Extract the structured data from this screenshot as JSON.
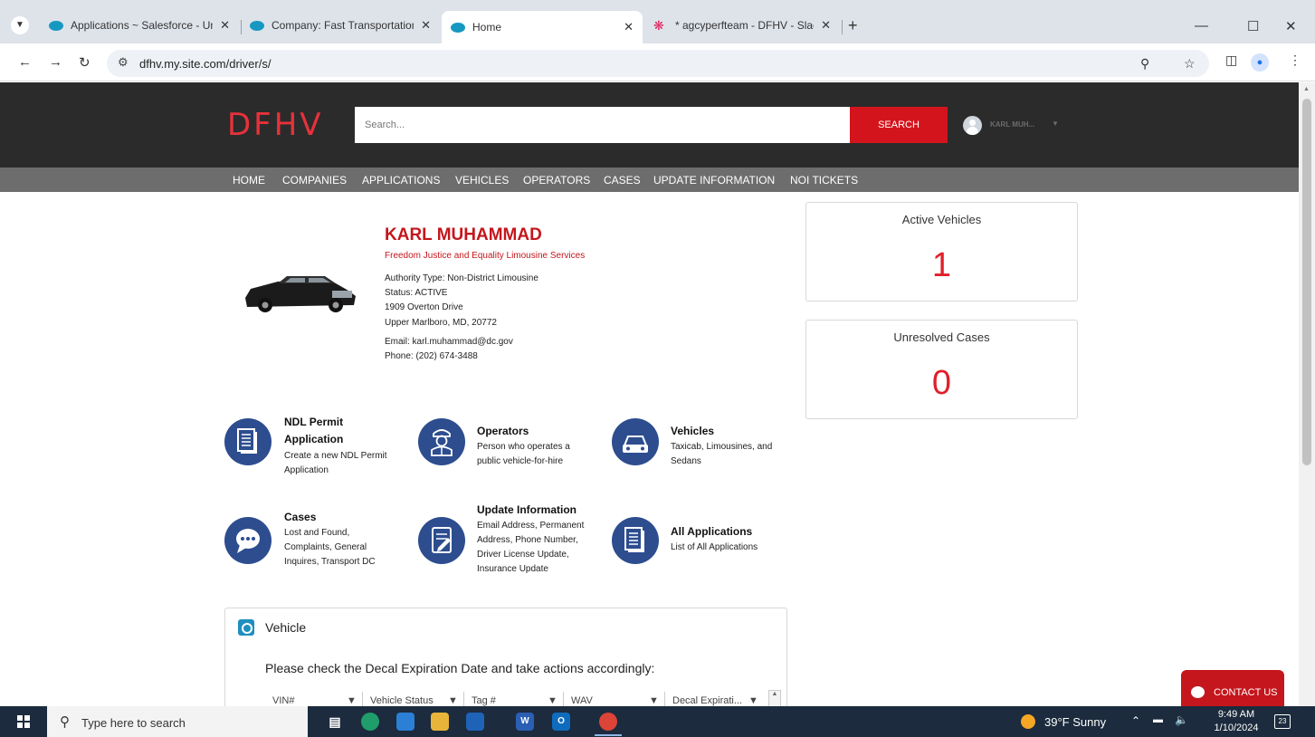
{
  "browser": {
    "tabs": [
      {
        "label": "Applications ~ Salesforce - Unli"
      },
      {
        "label": "Company: Fast Transportation S"
      },
      {
        "label": "Home"
      },
      {
        "label": "* agcyperfteam - DFHV - Slack"
      }
    ],
    "url": "dfhv.my.site.com/driver/s/"
  },
  "site": {
    "logo": "DFHV",
    "search_placeholder": "Search...",
    "search_button": "SEARCH",
    "user_name": "KARL MUH...",
    "nav": [
      "HOME",
      "COMPANIES",
      "APPLICATIONS",
      "VEHICLES",
      "OPERATORS",
      "CASES",
      "UPDATE INFORMATION",
      "NOI TICKETS"
    ]
  },
  "profile": {
    "name": "KARL MUHAMMAD",
    "company": "Freedom Justice and Equality Limousine Services",
    "authority": "Authority Type: Non-District Limousine",
    "status": "Status: ACTIVE",
    "address1": "1909 Overton Drive",
    "address2": "Upper Marlboro, MD, 20772",
    "email": "Email: karl.muhammad@dc.gov",
    "phone": "Phone: (202) 674-3488"
  },
  "stats": {
    "active_vehicles": {
      "title": "Active Vehicles",
      "value": "1"
    },
    "unresolved_cases": {
      "title": "Unresolved Cases",
      "value": "0"
    }
  },
  "tiles": {
    "ndl": {
      "title1": "NDL Permit",
      "title2": "Application",
      "desc1": "Create a new NDL Permit",
      "desc2": "Application",
      "icon": "document-stack-icon"
    },
    "operators": {
      "title": "Operators",
      "desc1": "Person who operates a",
      "desc2": "public vehicle-for-hire",
      "icon": "chauffeur-icon"
    },
    "vehicles": {
      "title": "Vehicles",
      "desc1": "Taxicab, Limousines, and",
      "desc2": "Sedans",
      "icon": "car-icon"
    },
    "cases": {
      "title": "Cases",
      "desc1": "Lost and Found,",
      "desc2": "Complaints, General",
      "desc3": "Inquires, Transport DC",
      "icon": "speech-bubble-icon"
    },
    "update": {
      "title": "Update Information",
      "desc1": "Email Address, Permanent",
      "desc2": "Address, Phone Number,",
      "desc3": "Driver License Update,",
      "desc4": "Insurance Update",
      "icon": "edit-form-icon"
    },
    "all_apps": {
      "title": "All Applications",
      "desc1": "List of All Applications",
      "icon": "document-stack-icon"
    }
  },
  "vehicle_card": {
    "title": "Vehicle",
    "message": "Please check the Decal Expiration Date and take actions accordingly:",
    "columns": [
      "VIN#",
      "Vehicle Status",
      "Tag #",
      "WAV",
      "Decal Expirati..."
    ]
  },
  "contact": {
    "label": "CONTACT US"
  },
  "taskbar": {
    "search_placeholder": "Type here to search",
    "weather": "39°F  Sunny",
    "time": "9:49 AM",
    "date": "1/10/2024",
    "notifications": "23"
  },
  "colors": {
    "brand_red": "#e8313b",
    "button_red": "#d4141c",
    "header_dark": "#2b2b2b",
    "nav_gray": "#6d6d6d",
    "tile_blue": "#2d4d8f",
    "stat_red": "#e0202a"
  }
}
